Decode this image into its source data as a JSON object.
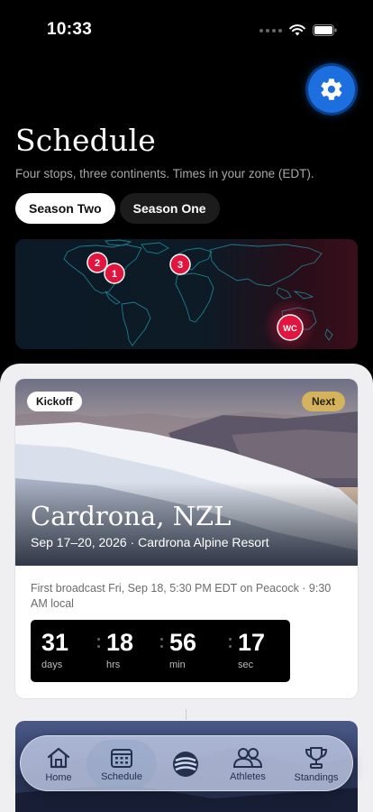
{
  "status_bar": {
    "time": "10:33"
  },
  "header": {
    "title": "Schedule",
    "subtitle": "Four stops, three continents. Times in your zone (EDT)."
  },
  "season_tabs": [
    {
      "label": "Season Two",
      "active": true
    },
    {
      "label": "Season One",
      "active": false
    }
  ],
  "map": {
    "markers": [
      {
        "label": "2"
      },
      {
        "label": "1"
      },
      {
        "label": "3"
      },
      {
        "label": "WC"
      }
    ]
  },
  "featured_event": {
    "badge_left": "Kickoff",
    "badge_right": "Next",
    "title": "Cardrona, NZL",
    "dates": "Sep 17–20, 2026 · Cardrona Alpine Resort",
    "broadcast": "First broadcast Fri, Sep 18, 5:30 PM EDT on Peacock · 9:30 AM local",
    "countdown": [
      {
        "value": "31",
        "unit": "days"
      },
      {
        "value": "18",
        "unit": "hrs"
      },
      {
        "value": "56",
        "unit": "min"
      },
      {
        "value": "17",
        "unit": "sec"
      }
    ]
  },
  "tab_bar": {
    "items": [
      {
        "label": "Home",
        "icon": "home-icon"
      },
      {
        "label": "Schedule",
        "icon": "calendar-icon",
        "active": true
      },
      {
        "label": "",
        "icon": "brand-logo-icon"
      },
      {
        "label": "Athletes",
        "icon": "athletes-icon"
      },
      {
        "label": "Standings",
        "icon": "trophy-icon"
      }
    ]
  },
  "colors": {
    "accent": "#1d6fe0",
    "marker": "#e0163f",
    "next_badge": "#d4b35c"
  }
}
